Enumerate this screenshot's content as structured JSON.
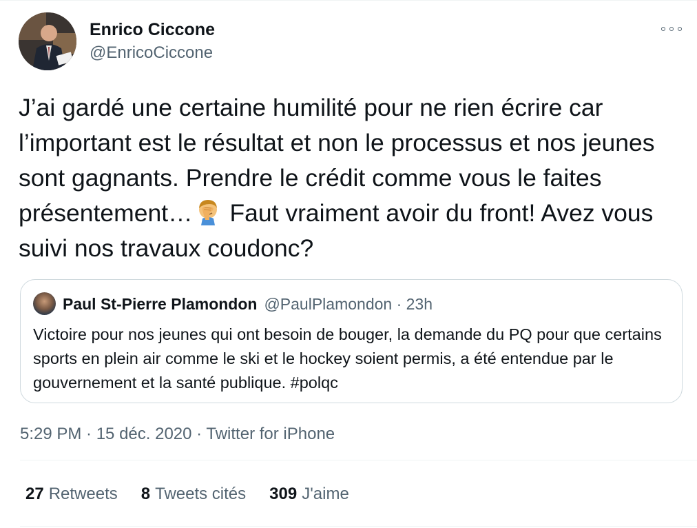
{
  "author": {
    "display_name": "Enrico Ciccone",
    "handle": "@EnricoCiccone"
  },
  "tweet": {
    "text_part1": "J’ai gardé une certaine humilité pour ne rien écrire car l’important est le résultat et non le processus et nos jeunes sont gagnants. Prendre le crédit comme vous le faites présentement…",
    "emoji_icon": "facepalm-icon",
    "text_part2": " Faut vraiment avoir du front! Avez vous suivi nos travaux coudonc?"
  },
  "quoted_tweet": {
    "display_name": "Paul St-Pierre Plamondon",
    "meta": "@PaulPlamondon · 23h",
    "text": "Victoire pour nos jeunes qui ont besoin de bouger, la demande du PQ pour que certains sports en plein air comme le ski et le hockey soient permis, a été entendue par le gouvernement et la santé publique. #polqc"
  },
  "timestamp": "5:29 PM · 15 déc. 2020 · Twitter for iPhone",
  "stats": {
    "retweets_count": "27",
    "retweets_label": "Retweets",
    "quotes_count": "8",
    "quotes_label": "Tweets cités",
    "likes_count": "309",
    "likes_label": "J'aime"
  },
  "colors": {
    "text_primary": "#0f1419",
    "text_secondary": "#536471",
    "border": "#cfd9de"
  }
}
